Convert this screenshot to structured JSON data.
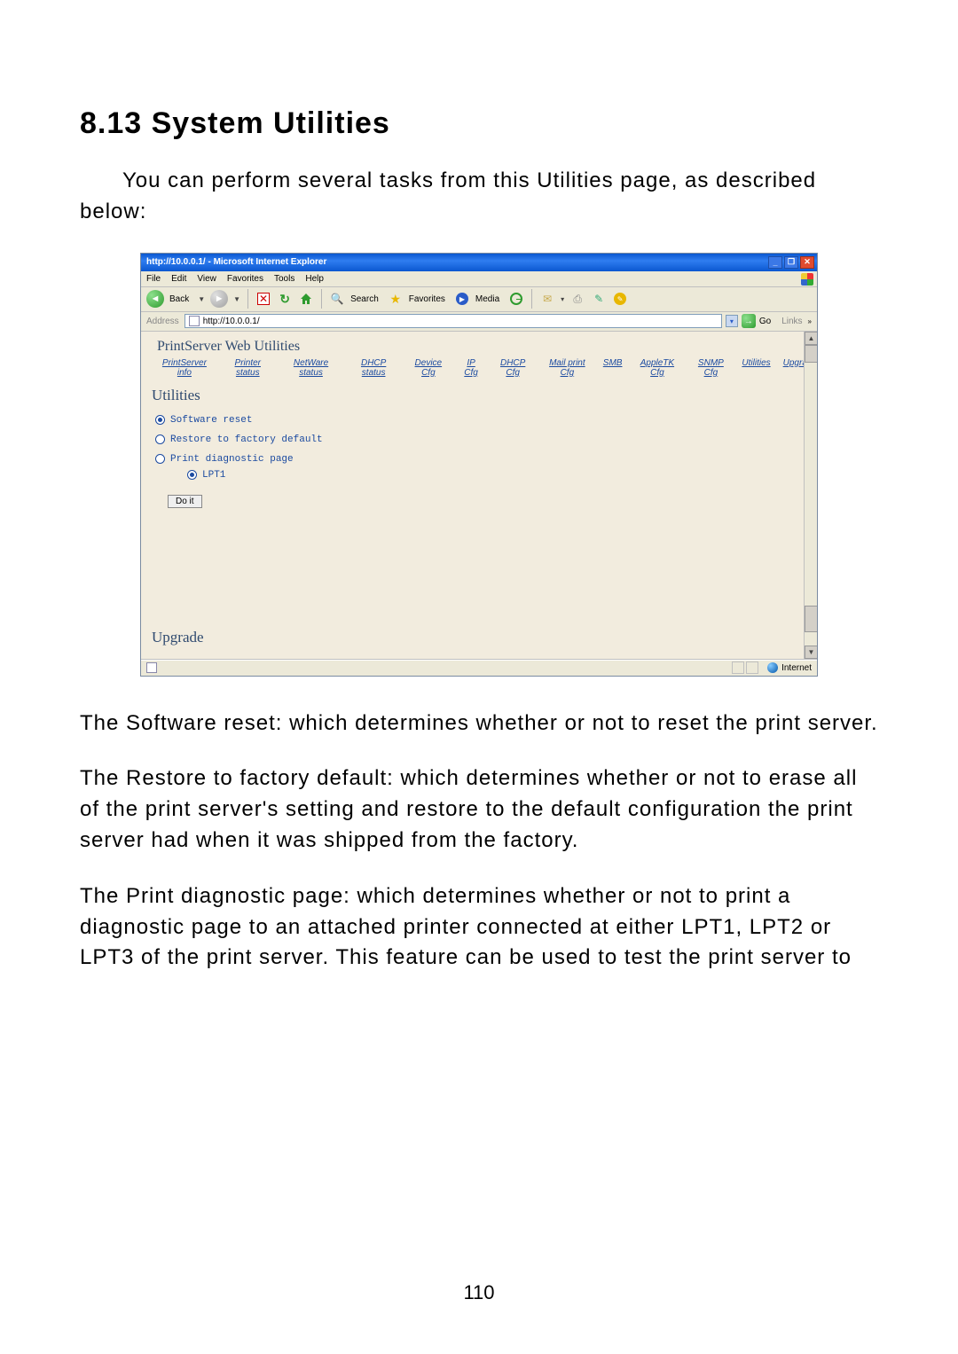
{
  "section": {
    "title": "8.13    System Utilities",
    "intro": "You can perform several tasks from this Utilities page, as described below:",
    "p_software": "The Software reset: which determines whether or not to reset the print server.",
    "p_restore": "The Restore to factory default: which determines whether or not to erase all of the print server's setting and restore to the default configuration the print server had when it was shipped from the factory.",
    "p_diag": "The Print diagnostic page: which determines whether or not to print a diagnostic page to an attached printer connected at either LPT1, LPT2 or LPT3 of the print server. This feature can be used to test the print server to"
  },
  "page_number": "110",
  "browser": {
    "title": "http://10.0.0.1/ - Microsoft Internet Explorer",
    "menus": {
      "file": "File",
      "edit": "Edit",
      "view": "View",
      "favorites": "Favorites",
      "tools": "Tools",
      "help": "Help"
    },
    "toolbar": {
      "back": "Back",
      "search": "Search",
      "favorites": "Favorites",
      "media": "Media"
    },
    "address": {
      "label": "Address",
      "value": "http://10.0.0.1/",
      "go": "Go",
      "links": "Links"
    },
    "ps": {
      "header": "PrintServer  Web  Utilities",
      "nav": {
        "info": "PrintServer info",
        "printer": "Printer status",
        "netware": "NetWare status",
        "dhcp_status": "DHCP status",
        "device": "Device Cfg",
        "ip": "IP Cfg",
        "dhcp_cfg": "DHCP Cfg",
        "mail": "Mail print Cfg",
        "smb": "SMB",
        "apple": "AppleTK Cfg",
        "snmp": "SNMP Cfg",
        "utilities": "Utilities",
        "upgrade": "Upgrade"
      },
      "section1": "Utilities",
      "options": {
        "reset": "Software reset",
        "restore": "Restore to factory default",
        "diag": "Print diagnostic page",
        "lpt1": "LPT1",
        "doit": "Do it"
      },
      "section2": "Upgrade"
    },
    "status": {
      "zone": "Internet"
    }
  }
}
